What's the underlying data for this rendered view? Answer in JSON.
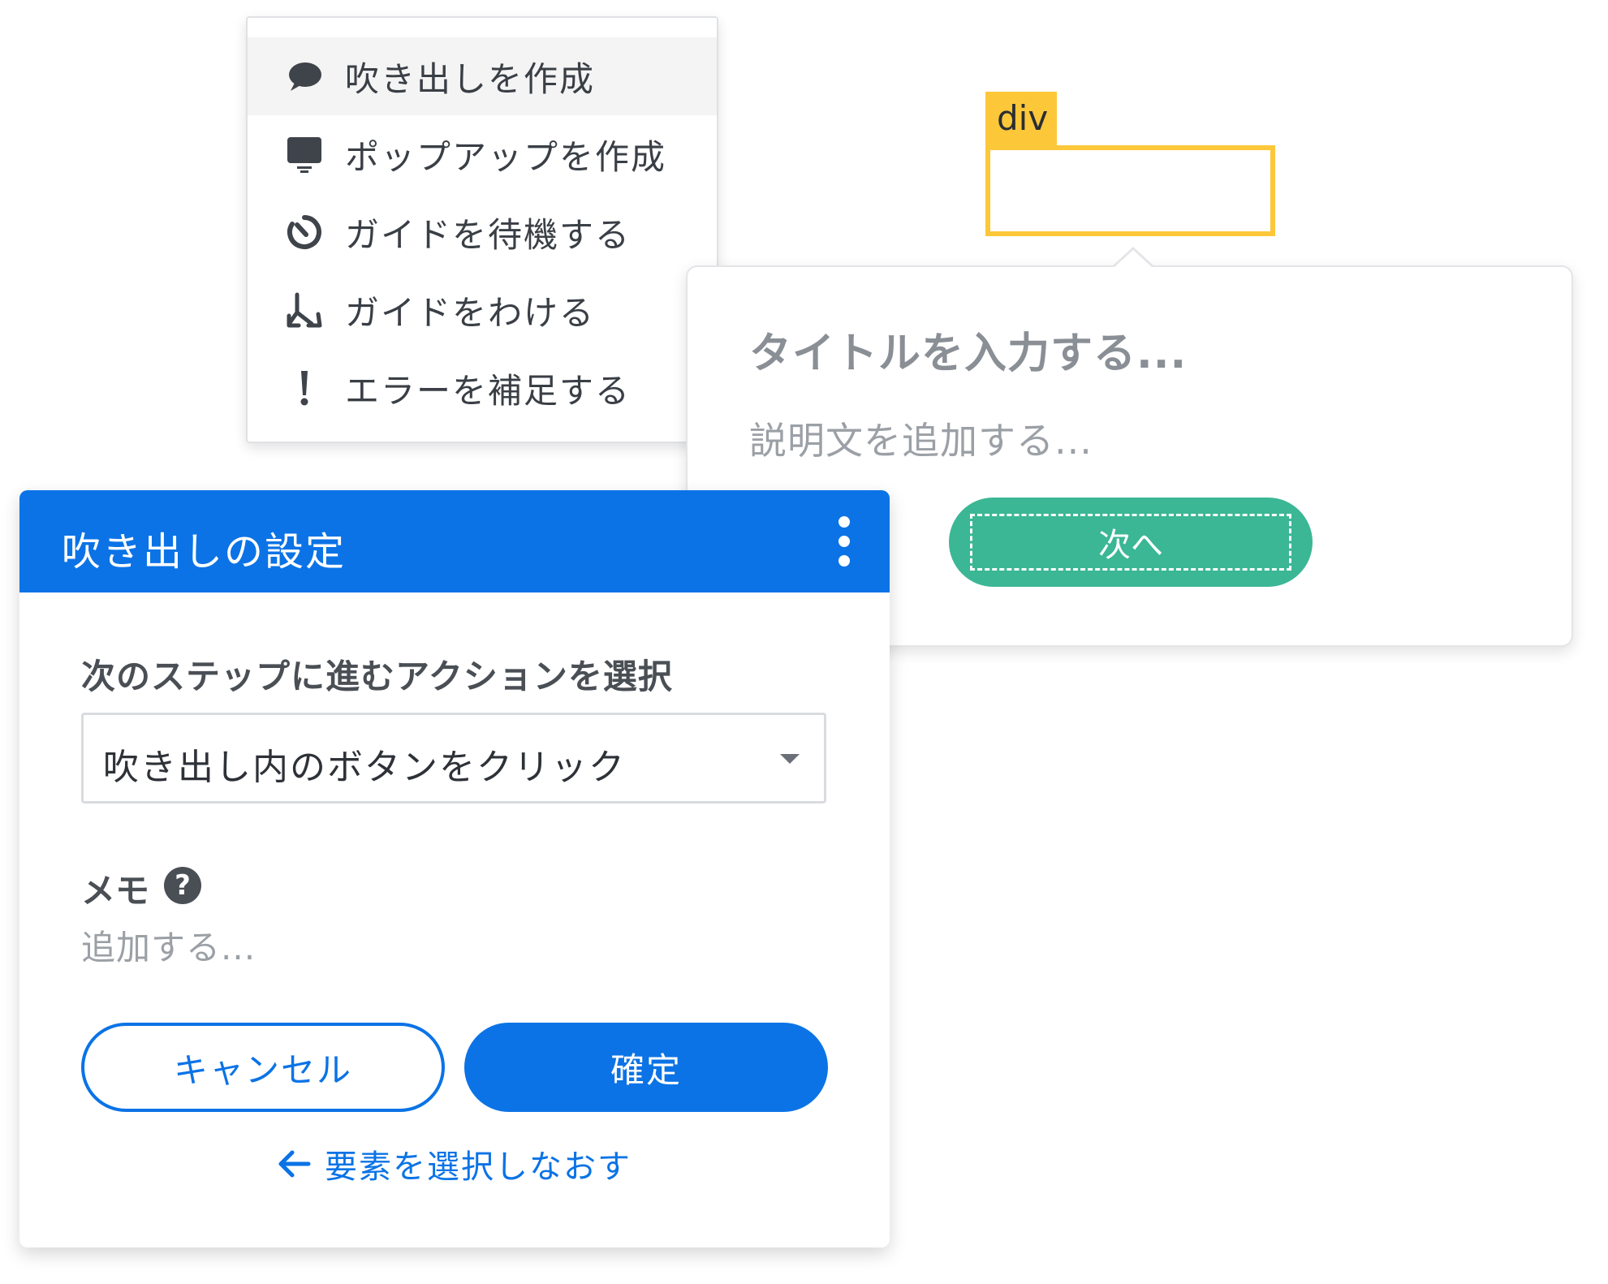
{
  "context_menu": {
    "items": [
      {
        "label": "吹き出しを作成",
        "icon": "speech-bubble-icon",
        "active": true
      },
      {
        "label": "ポップアップを作成",
        "icon": "monitor-icon",
        "active": false
      },
      {
        "label": "ガイドを待機する",
        "icon": "timer-icon",
        "active": false
      },
      {
        "label": "ガイドをわける",
        "icon": "split-arrows-icon",
        "active": false
      },
      {
        "label": "エラーを補足する",
        "icon": "exclamation-icon",
        "active": false
      }
    ]
  },
  "target_element": {
    "tag_label": "div",
    "highlight_color": "#fdc73a"
  },
  "tooltip_preview": {
    "title_placeholder": "タイトルを入力する...",
    "description_placeholder": "説明文を追加する...",
    "next_button_label": "次へ",
    "button_color": "#3bb795"
  },
  "settings_panel": {
    "title": "吹き出しの設定",
    "header_color": "#0b73e6",
    "action_label": "次のステップに進むアクションを選択",
    "action_selected": "吹き出し内のボタンをクリック",
    "memo_label": "メモ",
    "memo_help": "?",
    "memo_placeholder": "追加する...",
    "cancel_label": "キャンセル",
    "confirm_label": "確定",
    "reselect_label": "要素を選択しなおす"
  }
}
